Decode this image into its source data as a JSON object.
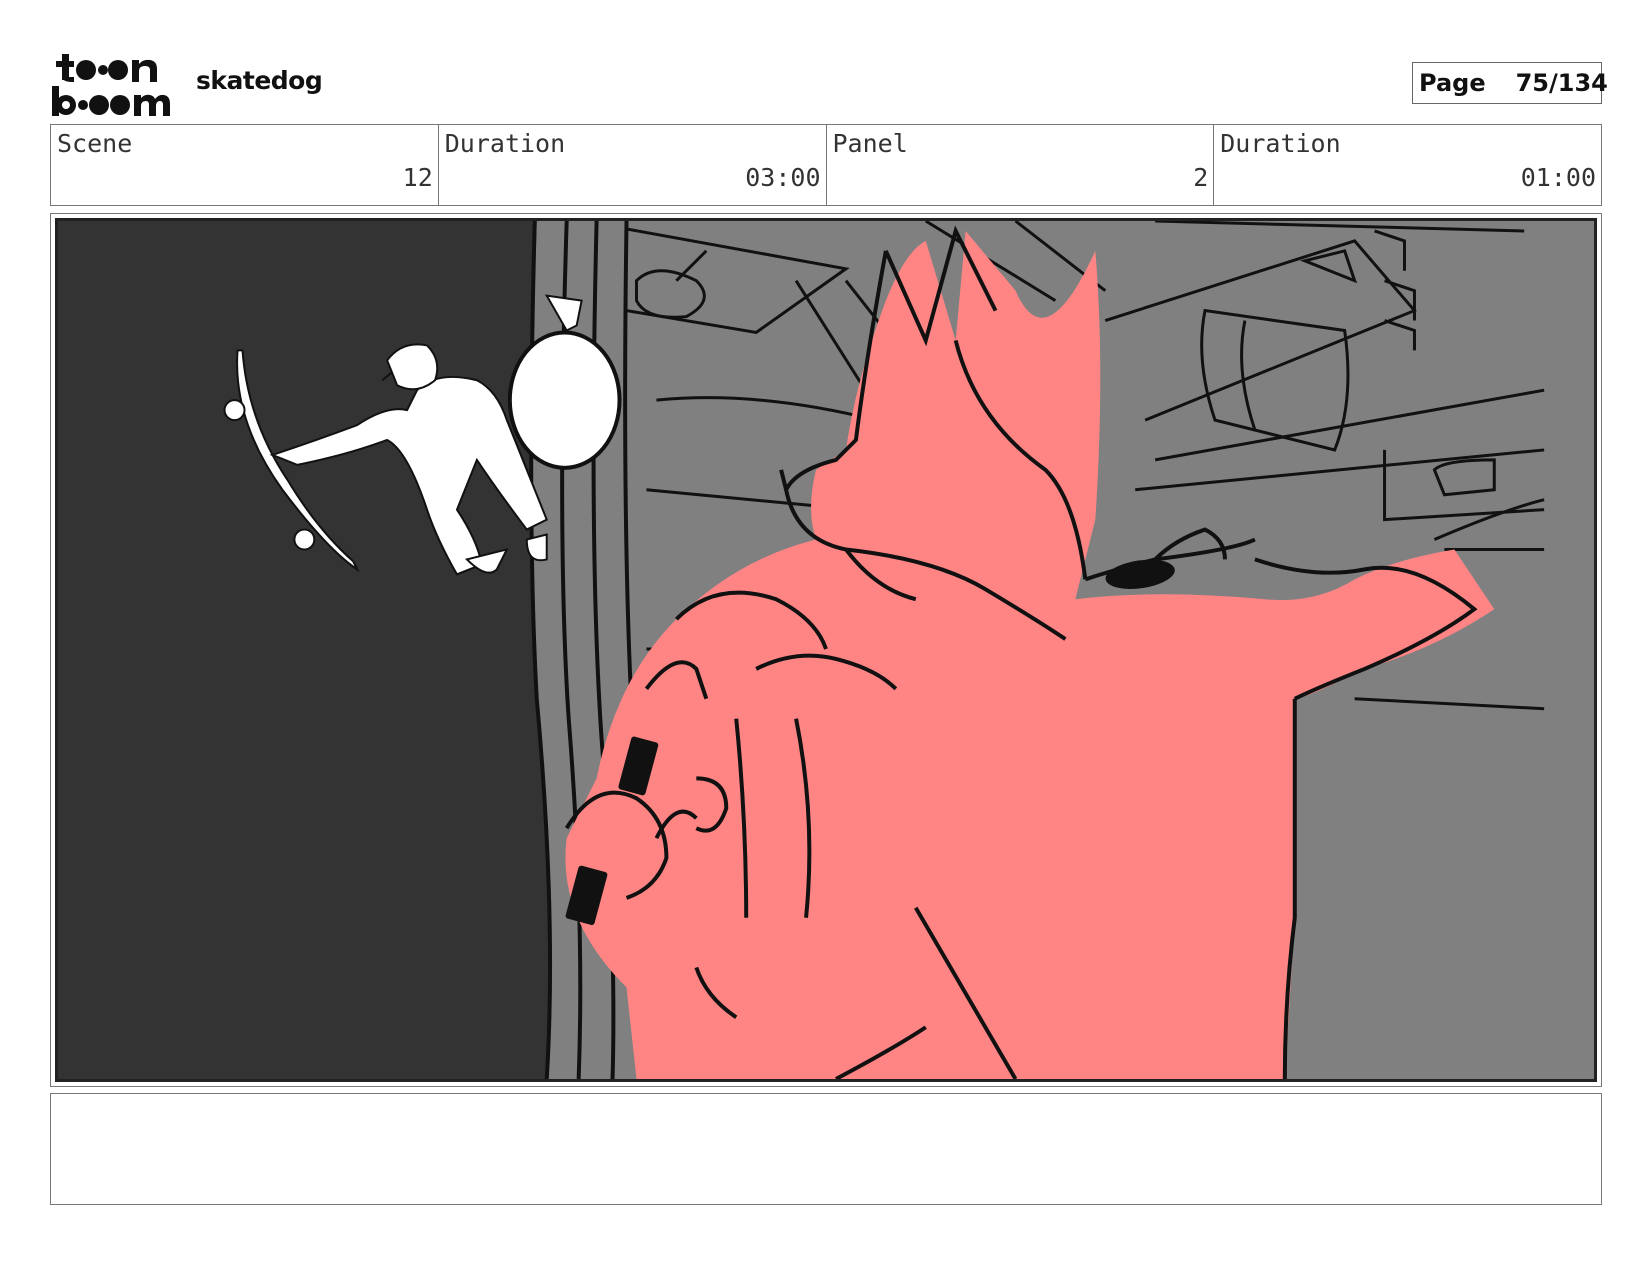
{
  "brand": {
    "logo_line1": "toon",
    "logo_line2": "boom"
  },
  "project": {
    "title": "skatedog"
  },
  "page": {
    "label": "Page",
    "value": "75/134"
  },
  "info": {
    "scene_label": "Scene",
    "scene_value": "12",
    "scene_duration_label": "Duration",
    "scene_duration_value": "03:00",
    "panel_label": "Panel",
    "panel_value": "2",
    "panel_duration_label": "Duration",
    "panel_duration_value": "01:00"
  },
  "notes": {
    "text": ""
  },
  "colors": {
    "dark_wall": "#333333",
    "background_gray": "#808080",
    "character_pink": "#ff8585",
    "line_black": "#111111"
  }
}
